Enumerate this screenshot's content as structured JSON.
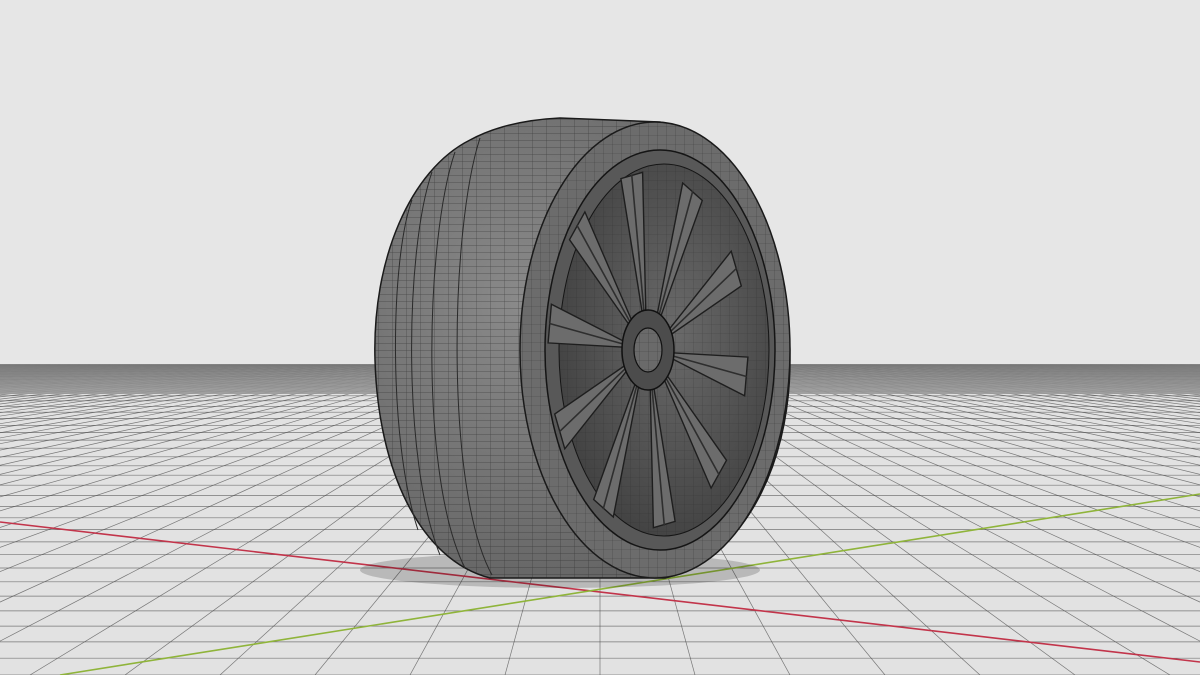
{
  "viewport": {
    "shading_mode": "wireframe-on-shaded",
    "colors": {
      "background": "#e6e6e6",
      "horizon_band": "#6f6f6f",
      "floor": "#e2e2e2",
      "grid_line": "#4a4a4a",
      "x_axis": "#c2344a",
      "y_axis": "#8fb43a",
      "tire_tread": "#7c7c7c",
      "tire_sidewall": "#6c6c6c",
      "rim": "#5a5a5a",
      "rim_dark": "#2e2e2e",
      "wire": "#1e1e1e"
    }
  },
  "scene": {
    "object": "wheel",
    "parts": {
      "tire": "tire",
      "rim": "rim",
      "spokes": 10,
      "hub": "hub"
    }
  }
}
